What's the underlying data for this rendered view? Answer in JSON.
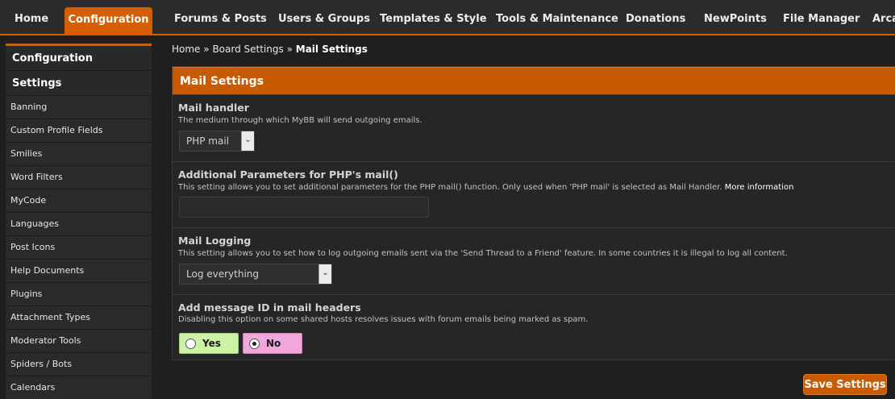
{
  "nav": {
    "tabs": [
      {
        "label": "Home",
        "active": false
      },
      {
        "label": "Configuration",
        "active": true
      },
      {
        "label": "Forums & Posts",
        "active": false
      },
      {
        "label": "Users & Groups",
        "active": false
      },
      {
        "label": "Templates & Style",
        "active": false
      },
      {
        "label": "Tools & Maintenance",
        "active": false
      },
      {
        "label": "Donations",
        "active": false
      },
      {
        "label": "NewPoints",
        "active": false
      },
      {
        "label": "File Manager",
        "active": false
      },
      {
        "label": "Arca",
        "active": false
      }
    ]
  },
  "sidebar": {
    "section_title": "Configuration",
    "group_title": "Settings",
    "items": [
      "Banning",
      "Custom Profile Fields",
      "Smilies",
      "Word Filters",
      "MyCode",
      "Languages",
      "Post Icons",
      "Help Documents",
      "Plugins",
      "Attachment Types",
      "Moderator Tools",
      "Spiders / Bots",
      "Calendars"
    ]
  },
  "breadcrumb": {
    "home": "Home",
    "sep1": "»",
    "section": "Board Settings",
    "sep2": "»",
    "current": "Mail Settings"
  },
  "panel": {
    "title": "Mail Settings",
    "settings": [
      {
        "title": "Mail handler",
        "description": "The medium through which MyBB will send outgoing emails.",
        "control": "select",
        "value": "PHP mail"
      },
      {
        "title": "Additional Parameters for PHP's mail()",
        "description": "This setting allows you to set additional parameters for the PHP mail() function. Only used when 'PHP mail' is selected as Mail Handler.",
        "link": "More information",
        "control": "text",
        "value": ""
      },
      {
        "title": "Mail Logging",
        "description": "This setting allows you to set how to log outgoing emails sent via the 'Send Thread to a Friend' feature. In some countries it is illegal to log all content.",
        "control": "select",
        "value": "Log everything"
      },
      {
        "title": "Add message ID in mail headers",
        "description": "Disabling this option on some shared hosts resolves issues with forum emails being marked as spam.",
        "control": "yesno",
        "yes_label": "Yes",
        "no_label": "No",
        "selected": "No"
      }
    ]
  },
  "save_button": "Save Settings",
  "colors": {
    "accent": "#d35f00",
    "yes_bg": "#ccf2a6",
    "no_bg": "#f0a8dc",
    "background": "#1f1f1f"
  }
}
